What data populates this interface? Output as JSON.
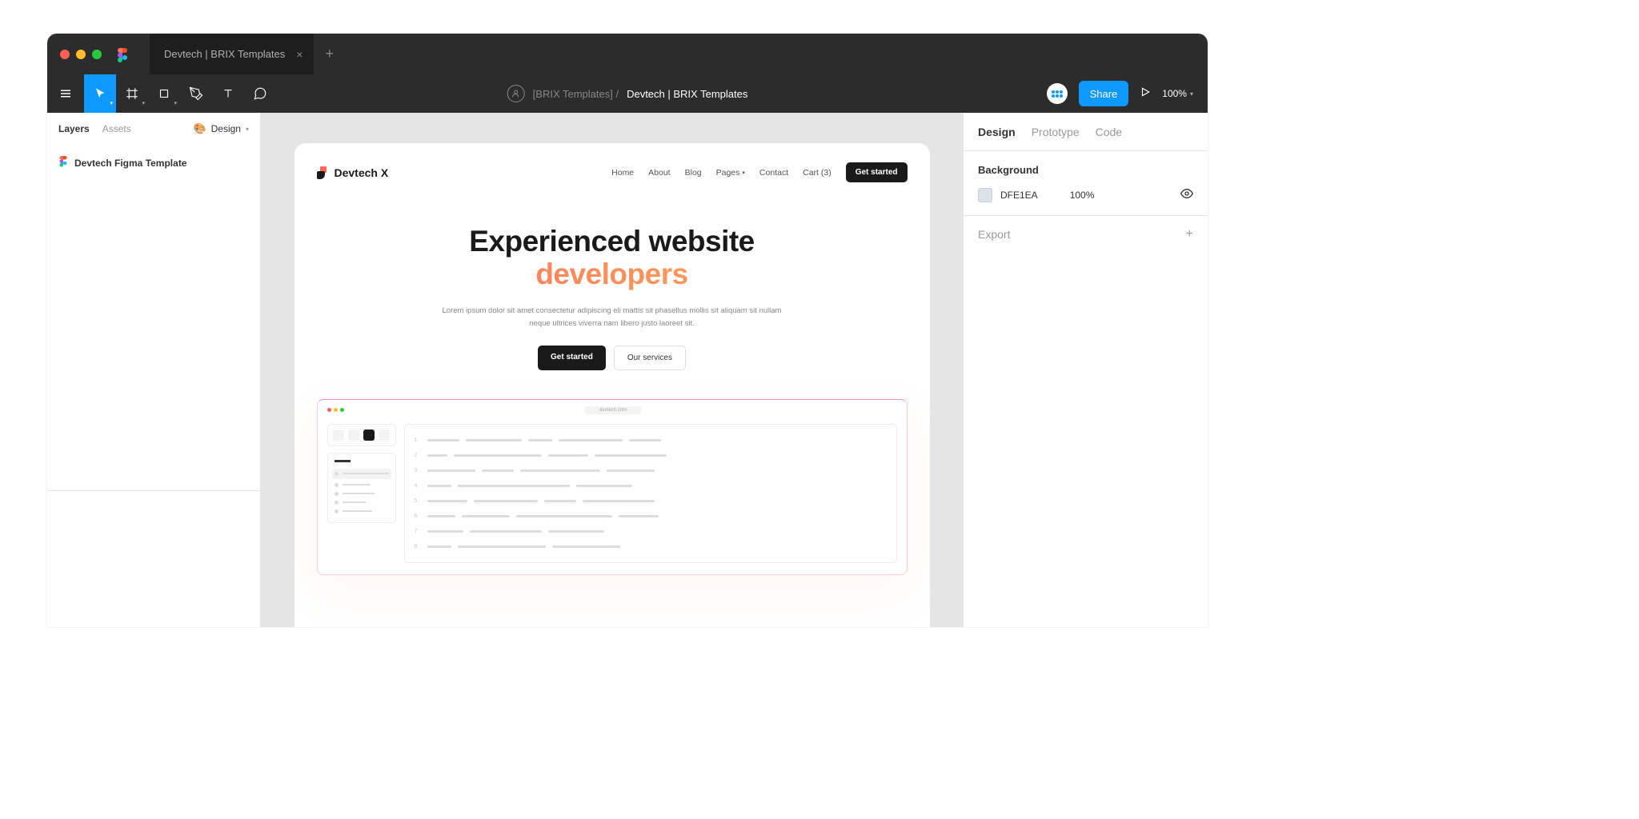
{
  "titlebar": {
    "tab_name": "Devtech | BRIX Templates"
  },
  "toolbar": {
    "breadcrumb_folder": "[BRIX Templates] /",
    "breadcrumb_file": "Devtech | BRIX Templates",
    "share_label": "Share",
    "zoom_label": "100%"
  },
  "left_panel": {
    "tab_layers": "Layers",
    "tab_assets": "Assets",
    "pages_label": "Design",
    "item_name": "Devtech Figma Template"
  },
  "right_panel": {
    "tab_design": "Design",
    "tab_prototype": "Prototype",
    "tab_code": "Code",
    "background_title": "Background",
    "bg_hex": "DFE1EA",
    "bg_opacity": "100%",
    "export_label": "Export"
  },
  "artboard": {
    "logo_text": "Devtech X",
    "nav": {
      "home": "Home",
      "about": "About",
      "blog": "Blog",
      "pages": "Pages",
      "contact": "Contact",
      "cart": "Cart (3)",
      "cta": "Get started"
    },
    "hero": {
      "line1": "Experienced website",
      "line2": "developers",
      "sub": "Lorem ipsum dolor sit amet consectetur adipiscing eli mattis sit phasellus mollis sit aliquam sit nullam neque ultrices viverra nam libero justo laoreet sit.",
      "btn1": "Get started",
      "btn2": "Our services"
    },
    "browser_url": "devtech.com"
  }
}
